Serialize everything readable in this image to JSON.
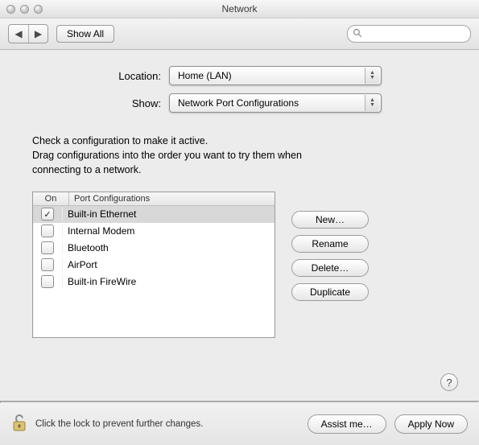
{
  "window": {
    "title": "Network"
  },
  "toolbar": {
    "show_all": "Show All",
    "search_placeholder": ""
  },
  "form": {
    "location_label": "Location:",
    "location_value": "Home (LAN)",
    "show_label": "Show:",
    "show_value": "Network Port Configurations"
  },
  "instructions": {
    "line1": "Check a configuration to make it active.",
    "line2": "Drag configurations into the order you want to try them when",
    "line3": "connecting to a network."
  },
  "list": {
    "header_on": "On",
    "header_name": "Port Configurations",
    "items": [
      {
        "on": true,
        "name": "Built-in Ethernet",
        "selected": true
      },
      {
        "on": false,
        "name": "Internal Modem",
        "selected": false
      },
      {
        "on": false,
        "name": "Bluetooth",
        "selected": false
      },
      {
        "on": false,
        "name": "AirPort",
        "selected": false
      },
      {
        "on": false,
        "name": "Built-in FireWire",
        "selected": false
      }
    ]
  },
  "side_buttons": {
    "new": "New…",
    "rename": "Rename",
    "delete": "Delete…",
    "duplicate": "Duplicate"
  },
  "help": {
    "label": "?"
  },
  "footer": {
    "lock_text": "Click the lock to prevent further changes.",
    "assist": "Assist me…",
    "apply": "Apply Now"
  }
}
